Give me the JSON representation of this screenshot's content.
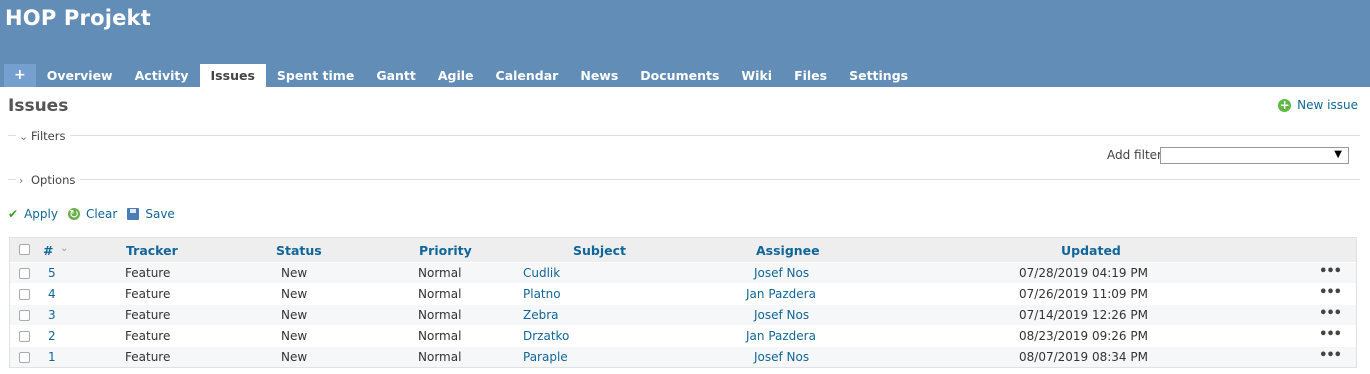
{
  "header": {
    "project_title": "HOP Projekt",
    "new_tab_label": "+",
    "tabs": [
      {
        "label": "Overview"
      },
      {
        "label": "Activity"
      },
      {
        "label": "Issues"
      },
      {
        "label": "Spent time"
      },
      {
        "label": "Gantt"
      },
      {
        "label": "Agile"
      },
      {
        "label": "Calendar"
      },
      {
        "label": "News"
      },
      {
        "label": "Documents"
      },
      {
        "label": "Wiki"
      },
      {
        "label": "Files"
      },
      {
        "label": "Settings"
      }
    ],
    "active_tab": "Issues"
  },
  "main": {
    "title": "Issues",
    "new_issue_label": "New issue",
    "filters_legend": "Filters",
    "options_legend": "Options",
    "add_filter_label": "Add filter",
    "add_filter_value": "",
    "actions": {
      "apply": "Apply",
      "clear": "Clear",
      "save": "Save"
    }
  },
  "table": {
    "columns": {
      "id": "#",
      "tracker": "Tracker",
      "status": "Status",
      "priority": "Priority",
      "subject": "Subject",
      "assignee": "Assignee",
      "updated": "Updated"
    },
    "rows": [
      {
        "id": "5",
        "tracker": "Feature",
        "status": "New",
        "priority": "Normal",
        "subject": "Cudlik",
        "assignee": "Josef Nos",
        "updated": "07/28/2019 04:19 PM"
      },
      {
        "id": "4",
        "tracker": "Feature",
        "status": "New",
        "priority": "Normal",
        "subject": "Platno",
        "assignee": "Jan Pazdera",
        "updated": "07/26/2019 11:09 PM"
      },
      {
        "id": "3",
        "tracker": "Feature",
        "status": "New",
        "priority": "Normal",
        "subject": "Zebra",
        "assignee": "Josef Nos",
        "updated": "07/14/2019 12:26 PM"
      },
      {
        "id": "2",
        "tracker": "Feature",
        "status": "New",
        "priority": "Normal",
        "subject": "Drzatko",
        "assignee": "Jan Pazdera",
        "updated": "08/23/2019 09:26 PM"
      },
      {
        "id": "1",
        "tracker": "Feature",
        "status": "New",
        "priority": "Normal",
        "subject": "Paraple",
        "assignee": "Josef Nos",
        "updated": "08/07/2019 08:34 PM"
      }
    ],
    "row_menu_label": "•••"
  }
}
